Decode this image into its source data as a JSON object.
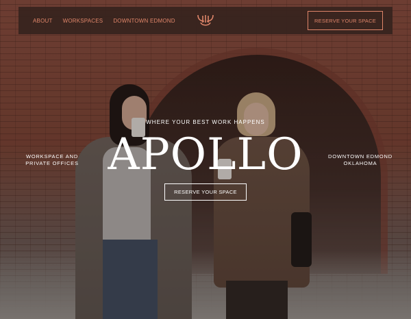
{
  "nav": {
    "links": [
      "ABOUT",
      "WORKSPACES",
      "DOWNTOWN EDMOND"
    ],
    "cta_label": "RESERVE YOUR SPACE",
    "logo_icon": "apollo-lyre-icon"
  },
  "hero": {
    "tagline": "WHERE YOUR BEST WORK HAPPENS",
    "title": "APOLLO",
    "left_text_line1": "WORKSPACE AND",
    "left_text_line2": "PRIVATE OFFICES",
    "right_text_line1": "DOWNTOWN EDMOND",
    "right_text_line2": "OKLAHOMA",
    "cta_label": "RESERVE YOUR SPACE"
  },
  "colors": {
    "accent": "#e0866a",
    "nav_bg": "#37241e",
    "text": "#ffffff"
  }
}
